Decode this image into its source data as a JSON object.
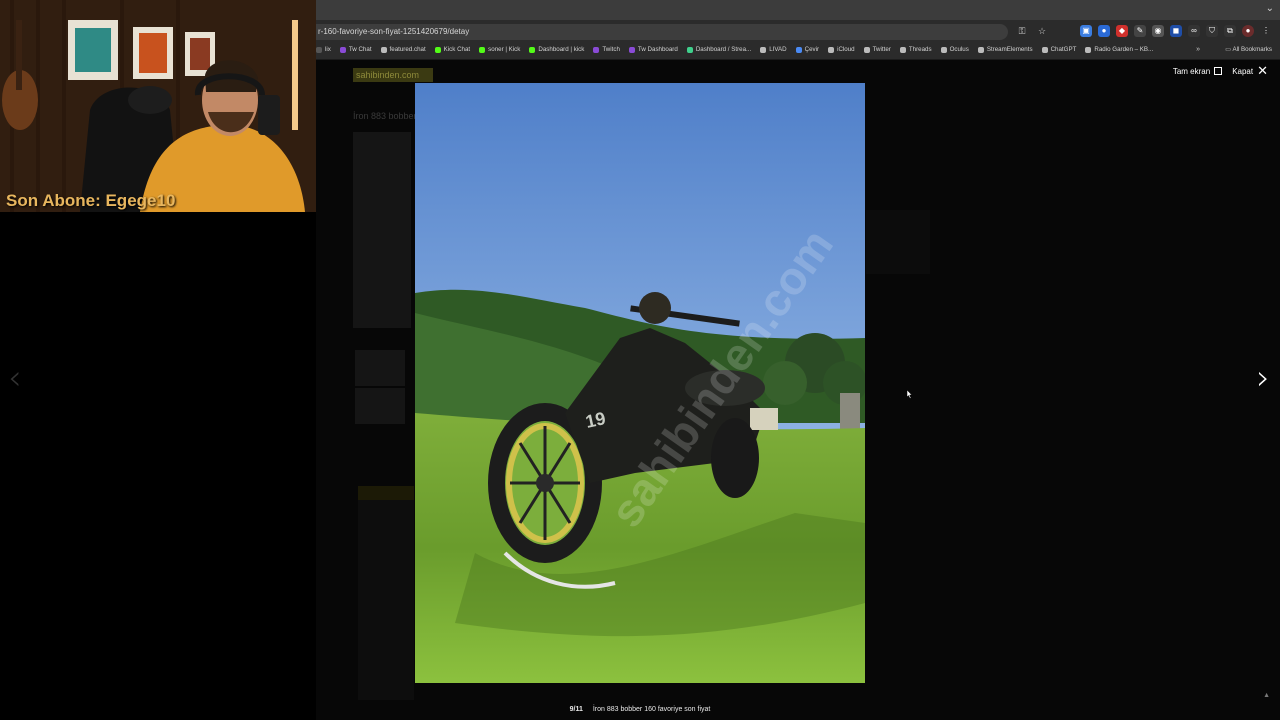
{
  "browser": {
    "url": "r-160-favoriye-son-fiyat-1251420679/detay",
    "bookmarks": [
      {
        "label": "lix",
        "color": "#555555"
      },
      {
        "label": "Tw Chat",
        "color": "#8a4bd6"
      },
      {
        "label": "featured.chat",
        "color": "#bbbbbb"
      },
      {
        "label": "Kick Chat",
        "color": "#53fc18"
      },
      {
        "label": "soner | Kick",
        "color": "#53fc18"
      },
      {
        "label": "Dashboard | kick",
        "color": "#53fc18"
      },
      {
        "label": "Twitch",
        "color": "#8a4bd6"
      },
      {
        "label": "Tw Dashboard",
        "color": "#8a4bd6"
      },
      {
        "label": "Dashboard / Strea...",
        "color": "#3fd08c"
      },
      {
        "label": "LIVAD",
        "color": "#bbbbbb"
      },
      {
        "label": "Çevir",
        "color": "#4a8af4"
      },
      {
        "label": "iCloud",
        "color": "#bbbbbb"
      },
      {
        "label": "Twitter",
        "color": "#bbbbbb"
      },
      {
        "label": "Threads",
        "color": "#bbbbbb"
      },
      {
        "label": "Oculus",
        "color": "#bbbbbb"
      },
      {
        "label": "StreamElements",
        "color": "#bbbbbb"
      },
      {
        "label": "ChatGPT",
        "color": "#bbbbbb"
      },
      {
        "label": "Radio Garden – KB...",
        "color": "#bbbbbb"
      }
    ],
    "all_bookmarks": "All Bookmarks",
    "more_bookmarks": "»"
  },
  "background_page": {
    "logo": "sahibinden.com",
    "title": "İron 883 bobber"
  },
  "lightbox": {
    "fullscreen_label": "Tam ekran",
    "close_label": "Kapat",
    "prev_arrow": "‹",
    "next_arrow": "›",
    "counter": "9/11",
    "caption": "İron 883 bobber 160 favoriye son fiyat"
  },
  "webcam": {
    "overlay_text": "Son Abone: Egege10"
  }
}
